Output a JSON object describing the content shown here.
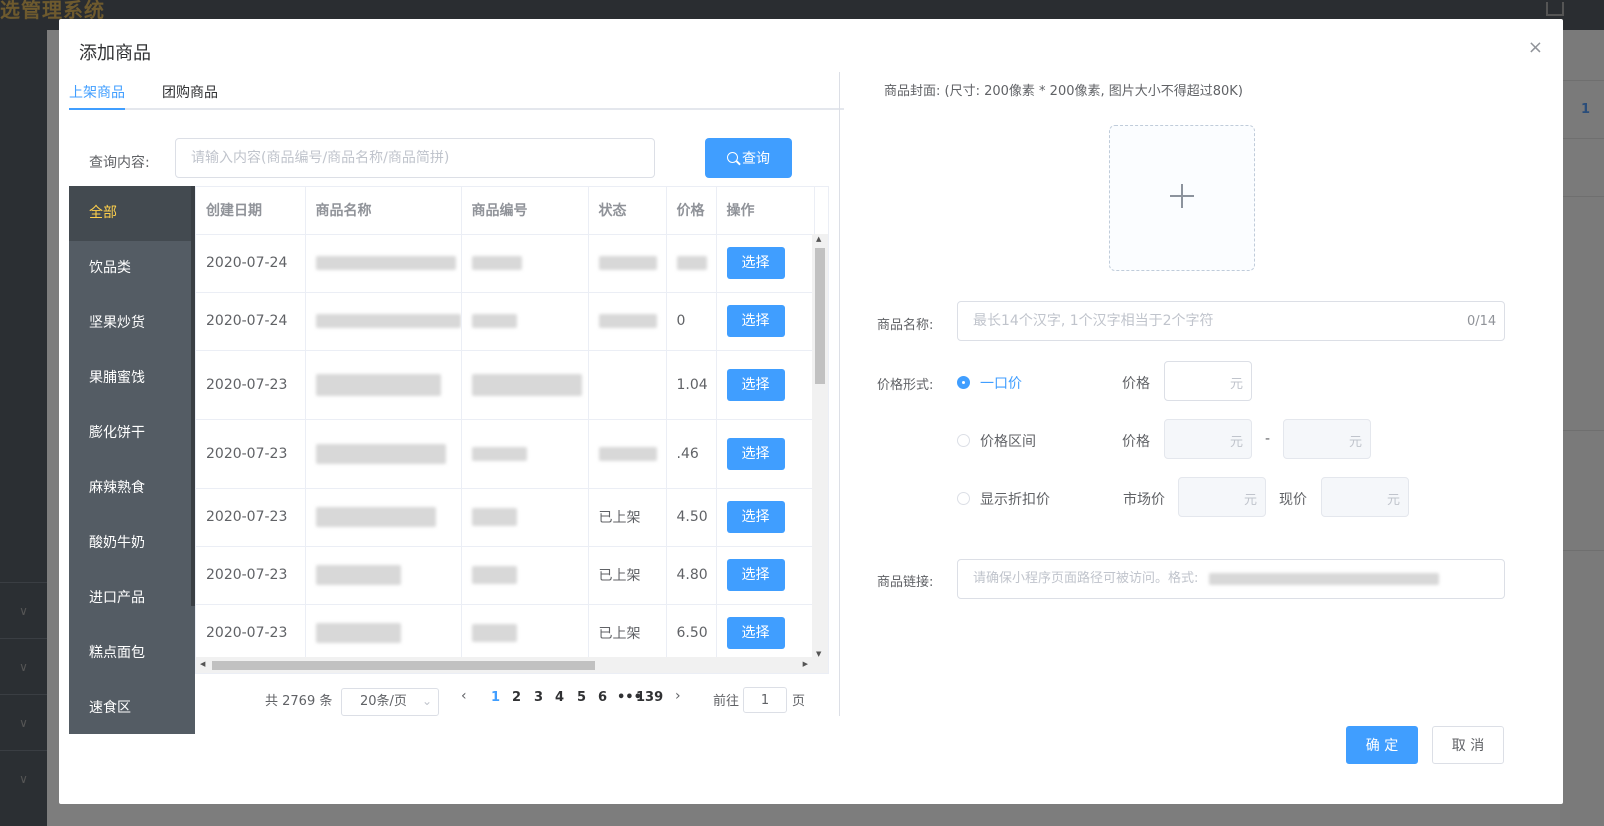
{
  "app": {
    "brand": "选管理系统",
    "right_badge": "1"
  },
  "dialog": {
    "title": "添加商品",
    "close_symbol": "×",
    "tabs": [
      {
        "label": "上架商品"
      },
      {
        "label": "团购商品"
      }
    ],
    "search": {
      "label": "查询内容:",
      "placeholder": "请输入内容(商品编号/商品名称/商品简拼)",
      "button_label": "查询"
    },
    "categories": [
      {
        "label": "全部"
      },
      {
        "label": "饮品类"
      },
      {
        "label": "坚果炒货"
      },
      {
        "label": "果脯蜜饯"
      },
      {
        "label": "膨化饼干"
      },
      {
        "label": "麻辣熟食"
      },
      {
        "label": "酸奶牛奶"
      },
      {
        "label": "进口产品"
      },
      {
        "label": "糕点面包"
      },
      {
        "label": "速食区"
      }
    ],
    "table": {
      "columns": [
        "创建日期",
        "商品名称",
        "商品编号",
        "状态",
        "价格",
        "操作"
      ],
      "rows": [
        {
          "date": "2020-07-24",
          "status": "",
          "price": "",
          "action": "选择"
        },
        {
          "date": "2020-07-24",
          "status": "",
          "price": "0",
          "action": "选择"
        },
        {
          "date": "2020-07-23",
          "status": "",
          "price": "1.04",
          "action": "选择"
        },
        {
          "date": "2020-07-23",
          "status": "",
          "price": ".46",
          "action": "选择"
        },
        {
          "date": "2020-07-23",
          "status": "已上架",
          "price": "4.50",
          "action": "选择"
        },
        {
          "date": "2020-07-23",
          "status": "已上架",
          "price": "4.80",
          "action": "选择"
        },
        {
          "date": "2020-07-23",
          "status": "已上架",
          "price": "6.50",
          "action": "选择"
        }
      ]
    },
    "pagination": {
      "total_text": "共 2769 条",
      "page_size": "20条/页",
      "pages": [
        "1",
        "2",
        "3",
        "4",
        "5",
        "6",
        "•••",
        "139"
      ],
      "current_page": "1",
      "goto_prefix": "前往",
      "goto_value": "1",
      "goto_suffix": "页"
    },
    "form": {
      "cover_label": "商品封面:  (尺寸: 200像素 * 200像素, 图片大小不得超过80K)",
      "name_label": "商品名称:",
      "name_placeholder": "最长14个汉字, 1个汉字相当于2个字符",
      "name_count": "0/14",
      "price_mode_label": "价格形式:",
      "price_modes": [
        {
          "label": "一口价",
          "checked": true
        },
        {
          "label": "价格区间",
          "checked": false
        },
        {
          "label": "显示折扣价",
          "checked": false
        }
      ],
      "price_label": "价格",
      "market_price_label": "市场价",
      "current_price_label": "现价",
      "unit": "元",
      "range_dash": "-",
      "link_label": "商品链接:",
      "link_placeholder": "请确保小程序页面路径可被访问。格式:"
    },
    "footer": {
      "confirm": "确 定",
      "cancel": "取 消"
    }
  },
  "colors": {
    "accent": "#409eff",
    "menu_bg": "#545c64",
    "menu_active": "#ffd04b"
  }
}
